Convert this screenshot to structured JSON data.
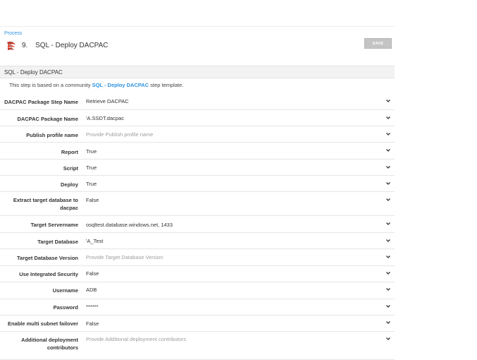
{
  "breadcrumb": "Process",
  "step": {
    "number": "9.",
    "title": "SQL - Deploy DACPAC"
  },
  "save_button": "SAVE",
  "section": {
    "title": "SQL - Deploy DACPAC",
    "intro_prefix": "This step is based on a community",
    "intro_link": "SQL - Deploy DACPAC",
    "intro_suffix": "step template."
  },
  "fields": [
    {
      "label": "DACPAC Package Step Name",
      "value": "Retrieve DACPAC",
      "placeholder": false
    },
    {
      "label": "DACPAC Package Name",
      "value": "'A.SSDT.dacpac",
      "placeholder": false
    },
    {
      "label": "Publish profile name",
      "value": "Provide Publish profile name",
      "placeholder": true
    },
    {
      "label": "Report",
      "value": "True",
      "placeholder": false
    },
    {
      "label": "Script",
      "value": "True",
      "placeholder": false
    },
    {
      "label": "Deploy",
      "value": "True",
      "placeholder": false
    },
    {
      "label": "Extract target database to dacpac",
      "value": "False",
      "placeholder": false
    },
    {
      "label": "Target Servername",
      "value": "osqltest.database.windows.net, 1433",
      "placeholder": false
    },
    {
      "label": "Target Database",
      "value": "'A_Test",
      "placeholder": false
    },
    {
      "label": "Target Database Version",
      "value": "Provide Target Database Version",
      "placeholder": true
    },
    {
      "label": "Use Integrated Security",
      "value": "False",
      "placeholder": false
    },
    {
      "label": "Username",
      "value": "ADB",
      "placeholder": false
    },
    {
      "label": "Password",
      "value": "******",
      "placeholder": false
    },
    {
      "label": "Enable multi subnet failover",
      "value": "False",
      "placeholder": false
    },
    {
      "label": "Additional deployment contributors",
      "value": "Provide Additional deployment contributors",
      "placeholder": true
    }
  ],
  "icons": {
    "step": "sql-server-icon",
    "expand": "chevron-down-icon"
  },
  "colors": {
    "link": "#2f93e0",
    "save_button_bg": "#c4c4c4",
    "section_bg": "#f2f2f2"
  }
}
